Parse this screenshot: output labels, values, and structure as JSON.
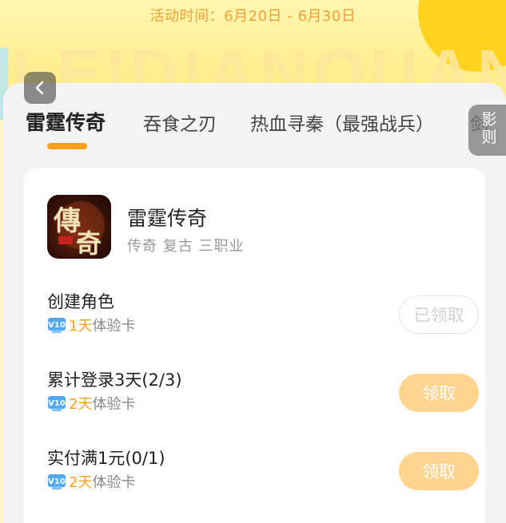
{
  "banner": {
    "date_range": "活动时间：6月20日 - 6月30日",
    "watermark": "LEIDIANQUAN"
  },
  "tabs": [
    {
      "label": "雷霆传奇",
      "active": true
    },
    {
      "label": "吞食之刃",
      "active": false
    },
    {
      "label": "热血寻秦（最强战兵）",
      "active": false
    },
    {
      "label": "剑",
      "active": false
    }
  ],
  "rules_button": {
    "label_line1": "影",
    "label_line2": "则"
  },
  "game": {
    "name": "雷霆传奇",
    "tags": "传奇 复古 三职业",
    "icon": "game-logo-icon"
  },
  "tasks": [
    {
      "title": "创建角色",
      "reward_days": "1天",
      "reward_card": "体验卡",
      "button_label": "已领取",
      "button_state": "claimed"
    },
    {
      "title": "累计登录3天(2/3)",
      "reward_days": "2天",
      "reward_card": "体验卡",
      "button_label": "领取",
      "button_state": "claimable"
    },
    {
      "title": "实付满1元(0/1)",
      "reward_days": "2天",
      "reward_card": "体验卡",
      "button_label": "领取",
      "button_state": "claimable"
    }
  ],
  "colors": {
    "accent": "#ff9f1c",
    "button_active": "#ffd48f",
    "background": "#f3f3f6"
  }
}
